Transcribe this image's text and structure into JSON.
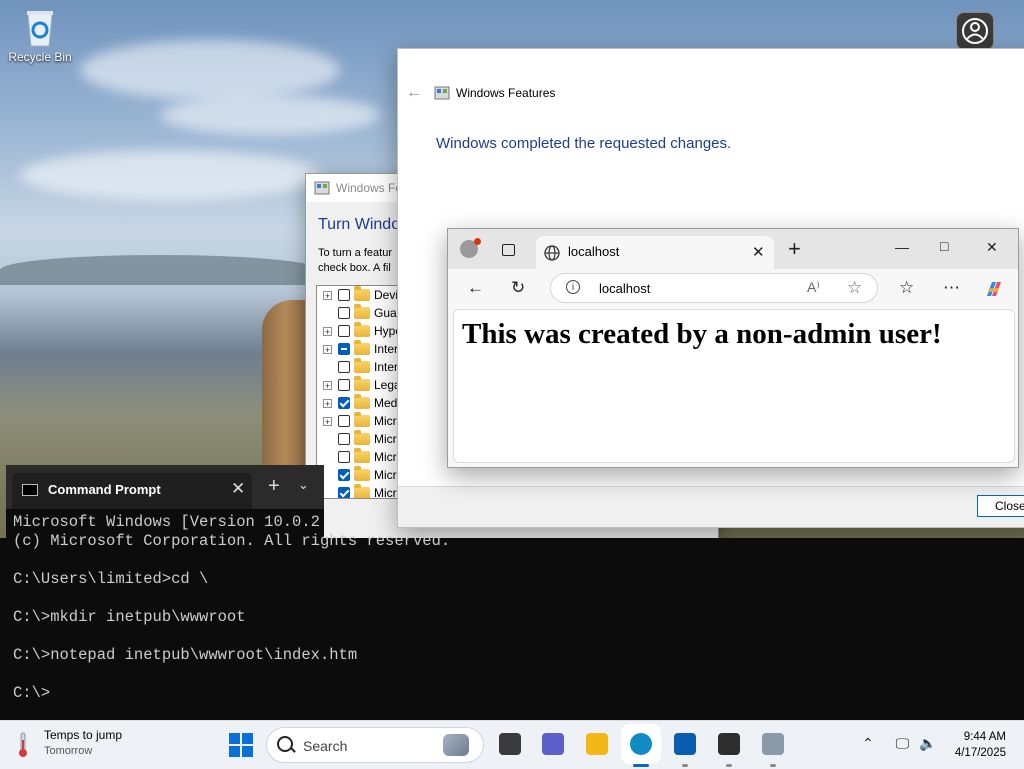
{
  "desktop": {
    "icons": [
      {
        "label": "Recycle Bin",
        "icon": "recycle-bin-icon"
      }
    ]
  },
  "windows_features_classic": {
    "title": "Windows Fea",
    "heading": "Turn Windo",
    "description_line1": "To turn a featur",
    "description_line2": "check box. A fil",
    "tree_items": [
      {
        "label": "Devic",
        "expandable": true,
        "state": "unchecked"
      },
      {
        "label": "Guar",
        "expandable": false,
        "state": "unchecked"
      },
      {
        "label": "Hype",
        "expandable": true,
        "state": "unchecked"
      },
      {
        "label": "Inter",
        "expandable": true,
        "state": "partial"
      },
      {
        "label": "Inter",
        "expandable": false,
        "state": "unchecked"
      },
      {
        "label": "Lega",
        "expandable": true,
        "state": "unchecked"
      },
      {
        "label": "Med",
        "expandable": true,
        "state": "checked"
      },
      {
        "label": "Micr",
        "expandable": true,
        "state": "unchecked"
      },
      {
        "label": "Micr",
        "expandable": false,
        "state": "unchecked"
      },
      {
        "label": "Micr",
        "expandable": false,
        "state": "unchecked"
      },
      {
        "label": "Micr",
        "expandable": false,
        "state": "checked"
      },
      {
        "label": "Micr",
        "expandable": false,
        "state": "checked"
      }
    ]
  },
  "windows_features_modern": {
    "title": "Windows Features",
    "message": "Windows completed the requested changes.",
    "close_label": "Close"
  },
  "edge": {
    "tab_title": "localhost",
    "address": "localhost",
    "read_aloud_label": "A⁾",
    "page_heading": "This was created by a non-admin user!"
  },
  "command_prompt": {
    "tab_title": "Command Prompt",
    "lines": [
      "Microsoft Windows [Version 10.0.2",
      "(c) Microsoft Corporation. All rights reserved.",
      "",
      "C:\\Users\\limited>cd \\",
      "",
      "C:\\>mkdir inetpub\\wwwroot",
      "",
      "C:\\>notepad inetpub\\wwwroot\\index.htm",
      "",
      "C:\\>"
    ]
  },
  "taskbar": {
    "weather_title": "Temps to jump",
    "weather_subtitle": "Tomorrow",
    "search_placeholder": "Search",
    "apps": [
      {
        "name": "task-view",
        "color": "#3b3b3b"
      },
      {
        "name": "teams",
        "color": "#5b5fc7"
      },
      {
        "name": "file-explorer",
        "color": "#f2b818"
      },
      {
        "name": "edge",
        "color": "#0f8cc4",
        "active": true
      },
      {
        "name": "microsoft-store",
        "color": "#0a5cb3"
      },
      {
        "name": "terminal",
        "color": "#2d2d2d"
      },
      {
        "name": "windows-features",
        "color": "#8a9aa8"
      }
    ],
    "time": "9:44 AM",
    "date": "4/17/2025"
  },
  "colors": {
    "accent": "#005fb8",
    "heading_blue": "#1e3d8f",
    "terminal_bg": "#0c0c0c"
  }
}
